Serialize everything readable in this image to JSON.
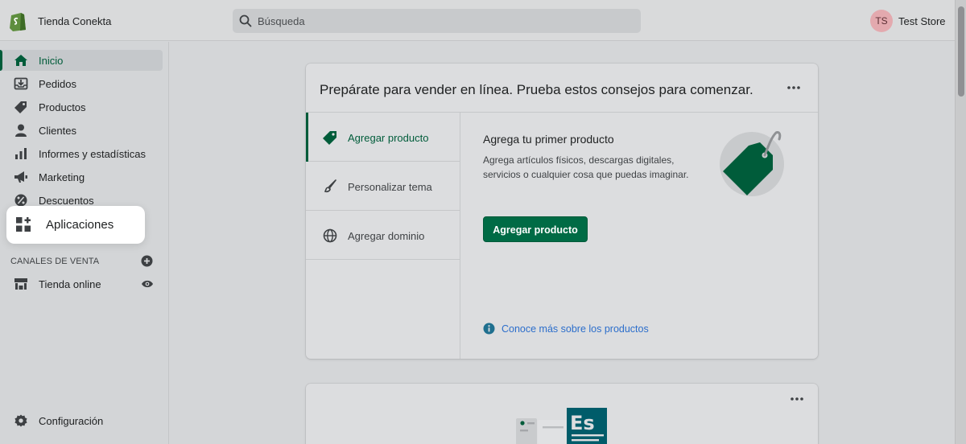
{
  "header": {
    "store_name": "Tienda Conekta",
    "search_placeholder": "Búsqueda",
    "avatar_initials": "TS",
    "user_name": "Test Store"
  },
  "sidebar": {
    "items": [
      {
        "label": "Inicio",
        "icon": "home-icon"
      },
      {
        "label": "Pedidos",
        "icon": "orders-icon"
      },
      {
        "label": "Productos",
        "icon": "tag-icon"
      },
      {
        "label": "Clientes",
        "icon": "person-icon"
      },
      {
        "label": "Informes y estadísticas",
        "icon": "bar-chart-icon"
      },
      {
        "label": "Marketing",
        "icon": "megaphone-icon"
      },
      {
        "label": "Descuentos",
        "icon": "discount-icon"
      },
      {
        "label": "Aplicaciones",
        "icon": "apps-icon"
      }
    ],
    "sales_channels_label": "CANALES DE VENTA",
    "channels": [
      {
        "label": "Tienda online",
        "icon": "store-icon"
      }
    ],
    "settings_label": "Configuración"
  },
  "setup_card": {
    "title": "Prepárate para vender en línea. Prueba estos consejos para comenzar.",
    "tabs": [
      {
        "label": "Agregar producto",
        "icon": "tag-icon"
      },
      {
        "label": "Personalizar tema",
        "icon": "brush-icon"
      },
      {
        "label": "Agregar dominio",
        "icon": "globe-icon"
      }
    ],
    "pane_title": "Agrega tu primer producto",
    "pane_body": "Agrega artículos físicos, descargas digitales, servicios o cualquier cosa que puedas imaginar.",
    "button_label": "Agregar producto",
    "learn_more": "Conoce más sobre los productos"
  },
  "second_card": {
    "illustration_text": "Es"
  },
  "colors": {
    "accent": "#006b45",
    "link": "#2c6ecb",
    "avatar": "#e3a9ae"
  }
}
